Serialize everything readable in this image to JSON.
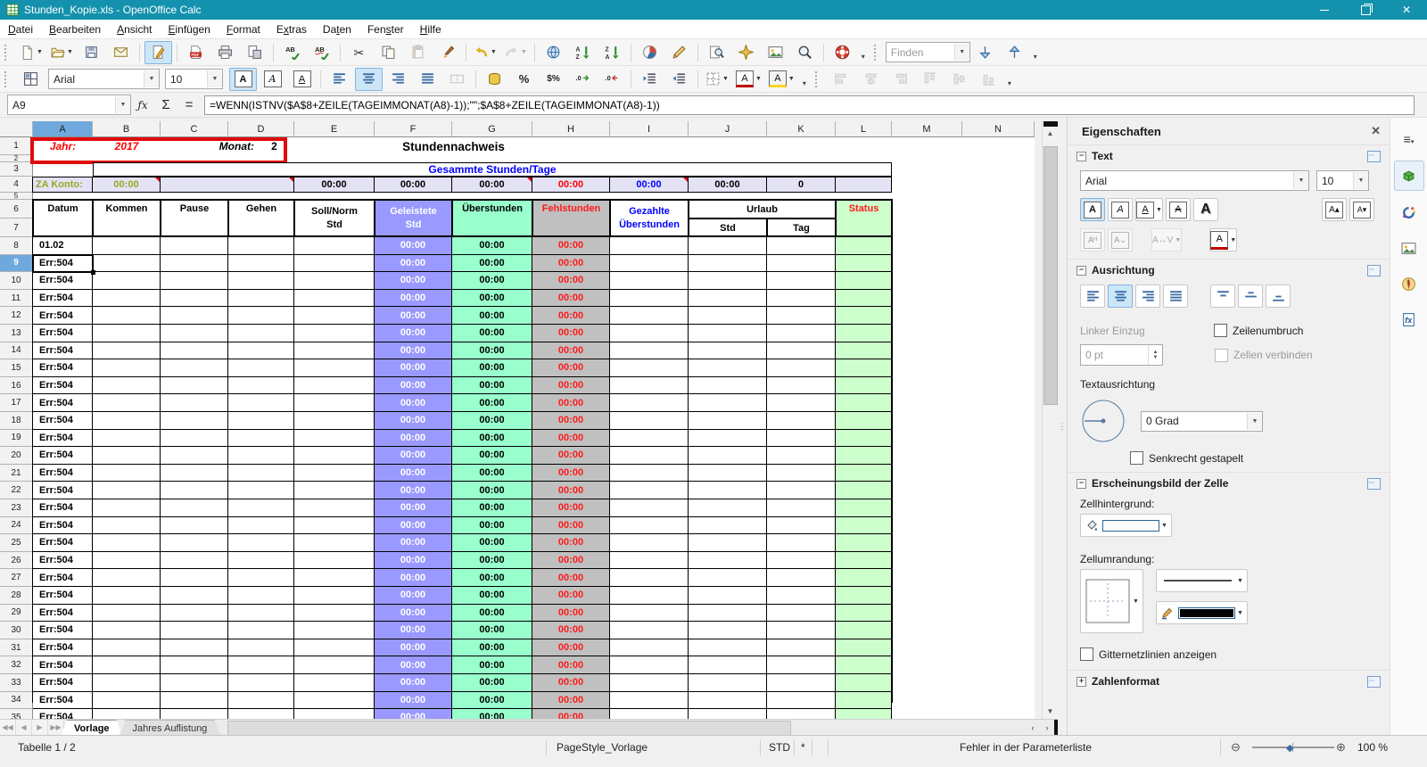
{
  "window": {
    "title": "Stunden_Kopie.xls - OpenOffice Calc",
    "controls": [
      "minimize",
      "maximize",
      "close"
    ]
  },
  "menu": {
    "items": [
      {
        "label": "Datei",
        "mnemonic": 0
      },
      {
        "label": "Bearbeiten",
        "mnemonic": 0
      },
      {
        "label": "Ansicht",
        "mnemonic": 0
      },
      {
        "label": "Einfügen",
        "mnemonic": 0
      },
      {
        "label": "Format",
        "mnemonic": 0
      },
      {
        "label": "Extras",
        "mnemonic": 1
      },
      {
        "label": "Daten",
        "mnemonic": 2
      },
      {
        "label": "Fenster",
        "mnemonic": 3
      },
      {
        "label": "Hilfe",
        "mnemonic": 0
      }
    ]
  },
  "toolbar_standard": {
    "buttons": [
      {
        "icon": "new-document",
        "dropdown": true
      },
      {
        "icon": "open",
        "dropdown": true
      },
      {
        "icon": "save"
      },
      {
        "icon": "email"
      },
      {
        "sep": true
      },
      {
        "icon": "edit-file",
        "active": true
      },
      {
        "sep": true
      },
      {
        "icon": "export-pdf"
      },
      {
        "icon": "print"
      },
      {
        "icon": "page-preview"
      },
      {
        "sep": true
      },
      {
        "icon": "spellcheck"
      },
      {
        "icon": "auto-spellcheck"
      },
      {
        "sep": true
      },
      {
        "icon": "cut"
      },
      {
        "icon": "copy"
      },
      {
        "icon": "paste",
        "disabled": true
      },
      {
        "icon": "format-paintbrush"
      },
      {
        "sep": true
      },
      {
        "icon": "undo",
        "dropdown": true
      },
      {
        "icon": "redo",
        "dropdown": true,
        "disabled": true
      },
      {
        "sep": true
      },
      {
        "icon": "hyperlink"
      },
      {
        "icon": "sort-ascending"
      },
      {
        "icon": "sort-descending"
      },
      {
        "sep": true
      },
      {
        "icon": "insert-chart"
      },
      {
        "icon": "show-draw-functions"
      },
      {
        "sep": true
      },
      {
        "icon": "find-replace"
      },
      {
        "icon": "navigator"
      },
      {
        "icon": "gallery"
      },
      {
        "icon": "zoom"
      },
      {
        "sep": true
      },
      {
        "icon": "help"
      },
      {
        "overflow": true
      }
    ]
  },
  "find_toolbar": {
    "value": "Finden",
    "buttons": [
      {
        "icon": "find-down"
      },
      {
        "icon": "find-up"
      },
      {
        "overflow": true
      }
    ]
  },
  "toolbar_format": {
    "font_name": "Arial",
    "font_size": "10",
    "lead_buttons": [
      {
        "icon": "grid-window"
      }
    ],
    "buttons": [
      {
        "icon": "bold",
        "active": true
      },
      {
        "icon": "italic"
      },
      {
        "icon": "underline"
      },
      {
        "sep": true
      },
      {
        "icon": "align-left"
      },
      {
        "icon": "align-center",
        "active": true
      },
      {
        "icon": "align-right"
      },
      {
        "icon": "align-justify"
      },
      {
        "icon": "merge-cells",
        "disabled": true
      },
      {
        "sep": true
      },
      {
        "icon": "currency"
      },
      {
        "icon": "percent"
      },
      {
        "icon": "standard-format"
      },
      {
        "icon": "add-decimal"
      },
      {
        "icon": "delete-decimal"
      },
      {
        "sep": true
      },
      {
        "icon": "decrease-indent"
      },
      {
        "icon": "increase-indent"
      },
      {
        "sep": true
      },
      {
        "icon": "borders",
        "dropdown": true
      },
      {
        "icon": "font-color",
        "dropdown": true
      },
      {
        "icon": "background-color",
        "dropdown": true
      },
      {
        "overflow": true
      },
      {
        "handle": true
      },
      {
        "icon": "obj-align-left",
        "disabled": true
      },
      {
        "icon": "obj-align-center",
        "disabled": true
      },
      {
        "icon": "obj-align-right",
        "disabled": true
      },
      {
        "icon": "obj-align-top",
        "disabled": true
      },
      {
        "icon": "obj-align-middle",
        "disabled": true
      },
      {
        "icon": "obj-align-bottom",
        "disabled": true
      },
      {
        "overflow": true
      }
    ]
  },
  "formula_bar": {
    "name_box": "A9",
    "fx_label": "ƒx",
    "sum_label": "Σ",
    "equals_label": "=",
    "formula": "=WENN(ISTNV($A$8+ZEILE(TAGEIMMONAT(A8)-1));\"\";$A$8+ZEILE(TAGEIMMONAT(A8)-1))"
  },
  "grid": {
    "col_letters": [
      "A",
      "B",
      "C",
      "D",
      "E",
      "F",
      "G",
      "H",
      "I",
      "J",
      "K",
      "L",
      "M",
      "N"
    ],
    "selected_cell": "A9",
    "row1": {
      "jahr_label": "Jahr:",
      "jahr_value": "2017",
      "monat_label": "Monat:",
      "monat_value": "2"
    },
    "sheet_title": "Stundennachweis",
    "row3_title": "Gesammte Stunden/Tage",
    "row4": {
      "label": "ZA Konto:",
      "b": "00:00",
      "e": "00:00",
      "f": "00:00",
      "g": "00:00",
      "h": "00:00",
      "i": "00:00",
      "j": "00:00",
      "k": "0"
    },
    "headers": {
      "datum": "Datum",
      "kommen": "Kommen",
      "pause": "Pause",
      "gehen": "Gehen",
      "soll": "Soll/Norm\nStd",
      "geleistete": "Geleistete\nStd",
      "ueberstunden": "Überstunden",
      "fehlstunden": "Fehlstunden",
      "gezahlte": "Gezahlte\nÜberstunden",
      "urlaub": "Urlaub",
      "urlaub_std": "Std",
      "urlaub_tag": "Tag",
      "status": "Status"
    },
    "data_rows": {
      "first_date": "01.02",
      "error_text": "Err:504",
      "time_text": "00:00",
      "count": 28
    }
  },
  "sheet_tabs": {
    "items": [
      {
        "label": "Vorlage",
        "active": true
      },
      {
        "label": "Jahres Auflistung",
        "active": false
      }
    ]
  },
  "sidebar": {
    "title": "Eigenschaften",
    "tabs": [
      "sidebar-menu",
      "sidebar-properties",
      "sidebar-styles",
      "sidebar-gallery",
      "sidebar-navigator",
      "sidebar-functions"
    ],
    "active_tab": "sidebar-properties",
    "sections": {
      "text": {
        "title": "Text",
        "font_name": "Arial",
        "font_size": "10"
      },
      "alignment": {
        "title": "Ausrichtung",
        "left_indent_label": "Linker Einzug",
        "left_indent_value": "0 pt",
        "wrap_label": "Zeilenumbruch",
        "merge_label": "Zellen verbinden",
        "orientation_label": "Textausrichtung",
        "degrees_value": "0 Grad",
        "stacked_label": "Senkrecht gestapelt"
      },
      "appearance": {
        "title": "Erscheinungsbild der Zelle",
        "background_label": "Zellhintergrund:",
        "border_label": "Zellumrandung:",
        "gridlines_label": "Gitternetzlinien anzeigen"
      },
      "number": {
        "title": "Zahlenformat"
      }
    }
  },
  "status_bar": {
    "sheet_info": "Tabelle 1 / 2",
    "page_style": "PageStyle_Vorlage",
    "insert_mode": "STD",
    "modified": "*",
    "message": "Fehler in der Parameterliste",
    "zoom_level": "100 %"
  },
  "colors": {
    "titlebar": "#1492ad",
    "worked_hours_purple": "#9999ff",
    "overtime_mint": "#99ffcc",
    "missing_gray": "#c0c0c0",
    "status_green": "#ccffcc",
    "summary_lavender": "#e4e3f6",
    "red_text": "#ff0000",
    "blue_text": "#0000ff",
    "za_konto_green": "#97a823",
    "highlight_blue": "#6fa8dc",
    "red_box": "#e00b0b"
  }
}
